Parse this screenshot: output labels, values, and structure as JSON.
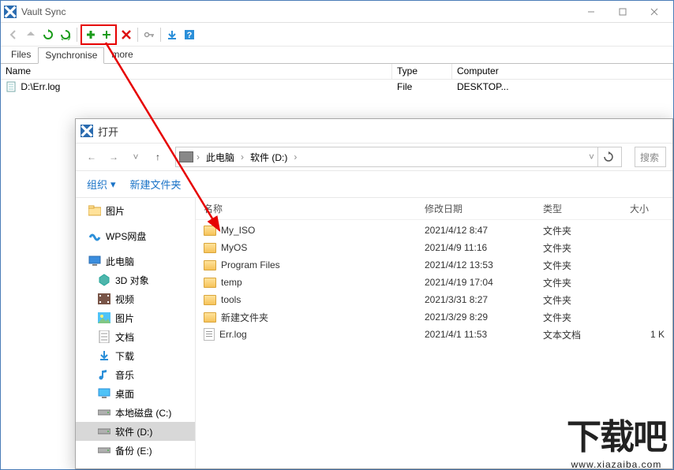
{
  "main": {
    "title": "Vault Sync",
    "tabs": {
      "files": "Files",
      "sync": "Synchronise",
      "more": "more"
    },
    "columns": {
      "name": "Name",
      "type": "Type",
      "computer": "Computer"
    },
    "row": {
      "name": "D:\\Err.log",
      "type": "File",
      "computer": "DESKTOP..."
    }
  },
  "dialog": {
    "title": "打开",
    "breadcrumb": {
      "pc": "此电脑",
      "drive": "软件 (D:)"
    },
    "search_placeholder": "搜索",
    "toolbar": {
      "organize": "组织",
      "newfolder": "新建文件夹"
    },
    "headers": {
      "name": "名称",
      "date": "修改日期",
      "type": "类型",
      "size": "大小"
    },
    "tree": [
      {
        "label": "图片",
        "icon": "folder"
      },
      {
        "label": "WPS网盘",
        "icon": "wps"
      },
      {
        "label": "此电脑",
        "icon": "pc"
      },
      {
        "label": "3D 对象",
        "icon": "3d",
        "indent": true
      },
      {
        "label": "视频",
        "icon": "video",
        "indent": true
      },
      {
        "label": "图片",
        "icon": "pics",
        "indent": true
      },
      {
        "label": "文档",
        "icon": "docs",
        "indent": true
      },
      {
        "label": "下载",
        "icon": "dl",
        "indent": true
      },
      {
        "label": "音乐",
        "icon": "music",
        "indent": true
      },
      {
        "label": "桌面",
        "icon": "desk",
        "indent": true
      },
      {
        "label": "本地磁盘 (C:)",
        "icon": "drive",
        "indent": true
      },
      {
        "label": "软件 (D:)",
        "icon": "drive",
        "indent": true,
        "selected": true
      },
      {
        "label": "备份 (E:)",
        "icon": "drive",
        "indent": true
      }
    ],
    "files": [
      {
        "name": "My_ISO",
        "date": "2021/4/12 8:47",
        "type": "文件夹",
        "size": "",
        "kind": "folder"
      },
      {
        "name": "MyOS",
        "date": "2021/4/9 11:16",
        "type": "文件夹",
        "size": "",
        "kind": "folder"
      },
      {
        "name": "Program Files",
        "date": "2021/4/12 13:53",
        "type": "文件夹",
        "size": "",
        "kind": "folder"
      },
      {
        "name": "temp",
        "date": "2021/4/19 17:04",
        "type": "文件夹",
        "size": "",
        "kind": "folder"
      },
      {
        "name": "tools",
        "date": "2021/3/31 8:27",
        "type": "文件夹",
        "size": "",
        "kind": "folder"
      },
      {
        "name": "新建文件夹",
        "date": "2021/3/29 8:29",
        "type": "文件夹",
        "size": "",
        "kind": "folder"
      },
      {
        "name": "Err.log",
        "date": "2021/4/1 11:53",
        "type": "文本文档",
        "size": "1 K",
        "kind": "txt"
      }
    ]
  },
  "watermark": {
    "big": "下载吧",
    "url": "www.xiazaiba.com"
  }
}
